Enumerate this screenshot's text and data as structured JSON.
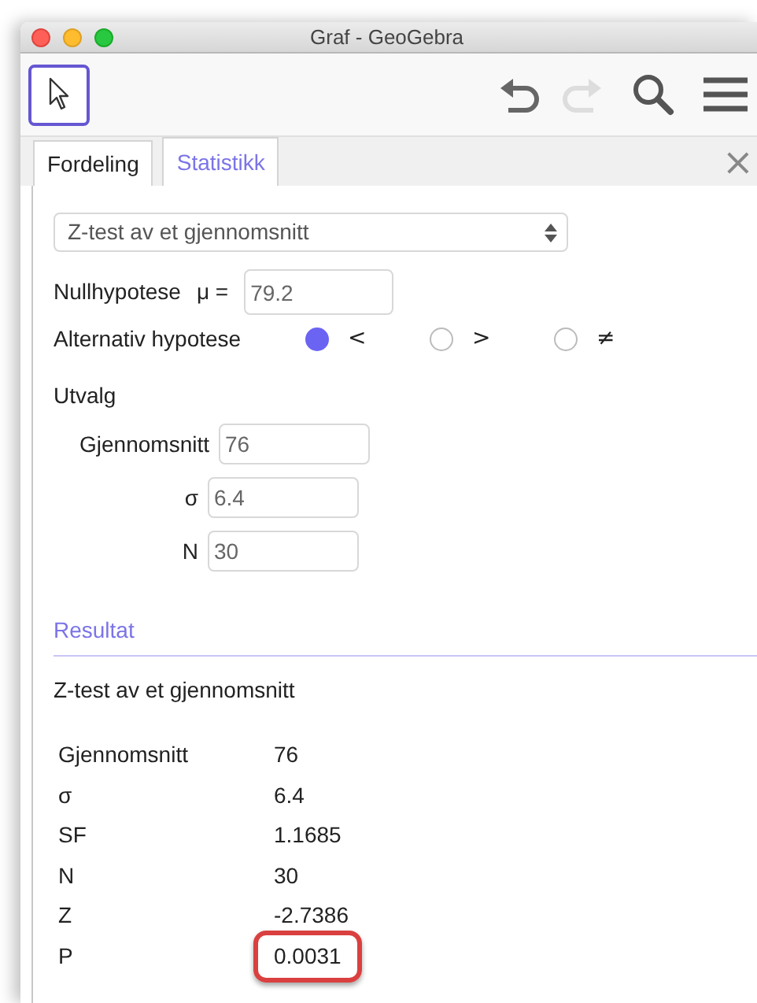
{
  "window": {
    "title": "Graf - GeoGebra"
  },
  "toolbar": {
    "tool_selected": true
  },
  "tabs": [
    {
      "label": "Fordeling",
      "selected": false
    },
    {
      "label": "Statistikk",
      "selected": true
    }
  ],
  "close": "×",
  "procedure": {
    "value": "Z-test av et gjennomsnitt"
  },
  "null_hypothesis": {
    "label": "Nullhypotese",
    "symbol": "μ =",
    "value": "79.2"
  },
  "alternative": {
    "label": "Alternativ hypotese",
    "options": [
      {
        "label": "<",
        "selected": true
      },
      {
        "label": ">",
        "selected": false
      },
      {
        "label": "≠",
        "selected": false
      }
    ]
  },
  "sample": {
    "title": "Utvalg",
    "fields": [
      {
        "label": "Gjennomsnitt",
        "value": "76"
      },
      {
        "label": "σ",
        "value": "6.4"
      },
      {
        "label": "N",
        "value": "30"
      }
    ]
  },
  "result": {
    "heading": "Resultat",
    "title": "Z-test av et gjennomsnitt",
    "rows": [
      {
        "label": "Gjennomsnitt",
        "value": "76",
        "highlighted": false
      },
      {
        "label": "σ",
        "value": "6.4",
        "highlighted": false
      },
      {
        "label": "SF",
        "value": "1.1685",
        "highlighted": false
      },
      {
        "label": "N",
        "value": "30",
        "highlighted": false
      },
      {
        "label": "Z",
        "value": "-2.7386",
        "highlighted": false
      },
      {
        "label": "P",
        "value": "0.0031",
        "highlighted": true
      }
    ]
  }
}
